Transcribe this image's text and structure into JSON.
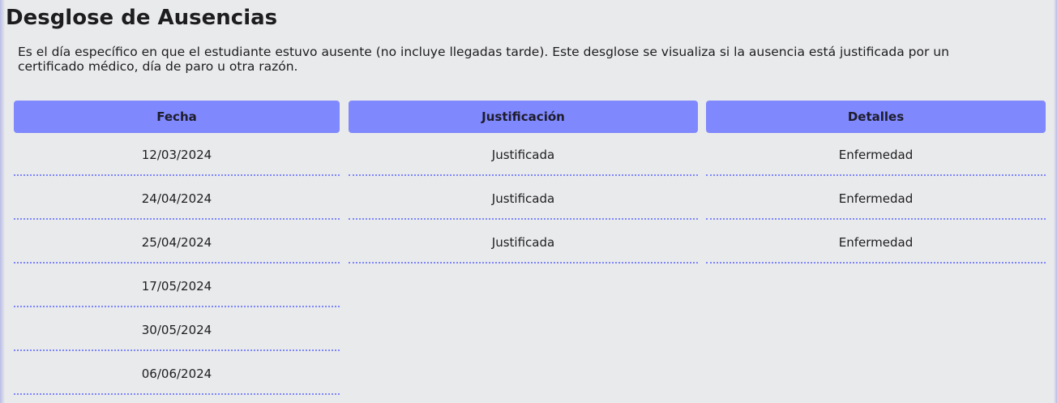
{
  "page": {
    "title": "Desglose de Ausencias",
    "description": "Es el día específico en que el estudiante estuvo ausente (no incluye llegadas tarde). Este desglose se visualiza si la ausencia está justificada por un certificado médico, día de paro u otra razón."
  },
  "table": {
    "headers": {
      "fecha": "Fecha",
      "justificacion": "Justificación",
      "detalles": "Detalles"
    },
    "fechas": [
      "12/03/2024",
      "24/04/2024",
      "25/04/2024",
      "17/05/2024",
      "30/05/2024",
      "06/06/2024"
    ],
    "justificaciones": [
      "Justificada",
      "Justificada",
      "Justificada"
    ],
    "detalles": [
      "Enfermedad",
      "Enfermedad",
      "Enfermedad"
    ]
  },
  "colors": {
    "header_bg": "#8088fe",
    "row_divider": "#7e86fb",
    "page_bg": "#e9eaeb"
  }
}
